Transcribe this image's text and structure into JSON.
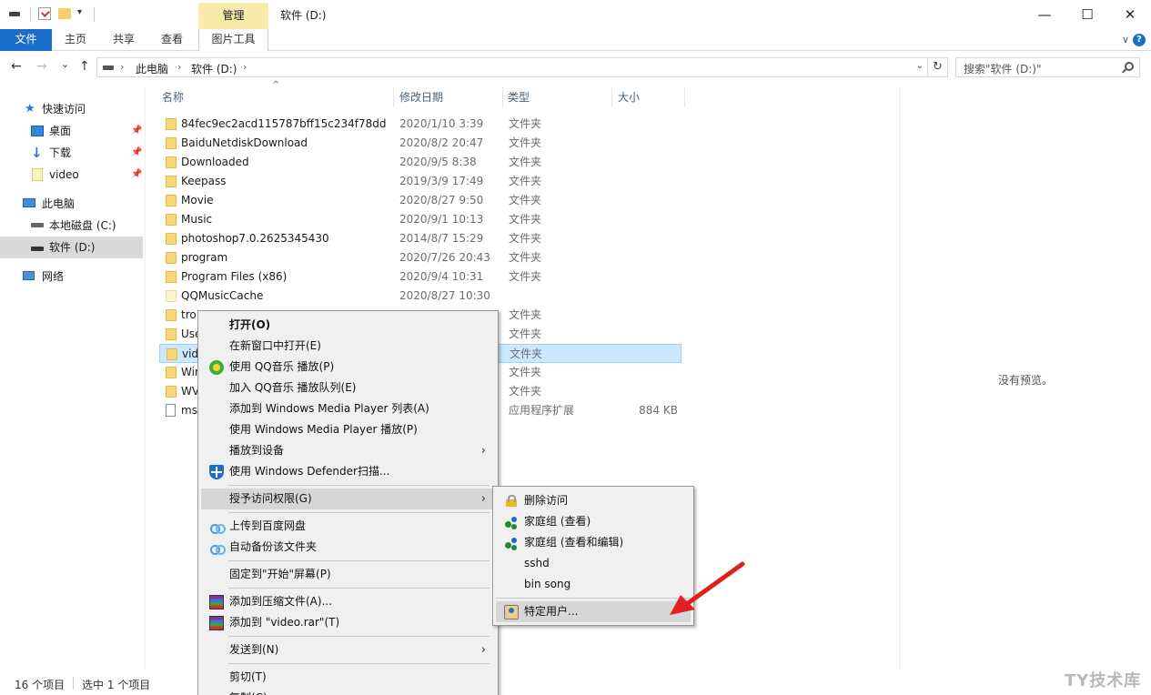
{
  "titlebar": {
    "manage_tab": "管理",
    "window_title": "软件 (D:)",
    "qa_dropdown": "▾",
    "minimize": "—",
    "maximize": "☐",
    "close": "✕"
  },
  "ribbon": {
    "tabs": [
      "文件",
      "主页",
      "共享",
      "查看",
      "图片工具"
    ],
    "expand_icon": "chevron-down-icon",
    "help_icon": "help-icon",
    "expand_glyph": "∨",
    "help_glyph": "?"
  },
  "nav": {
    "back": "←",
    "forward": "→",
    "recent": "⌄",
    "up": "↑",
    "breadcrumb": [
      "此电脑",
      "软件 (D:)"
    ],
    "sep": "›",
    "addr_dropdown": "⌄",
    "refresh": "↻",
    "search_placeholder": "搜索\"软件 (D:)\""
  },
  "sidebar": {
    "items": [
      {
        "label": "快速访问",
        "icon": "star-icon"
      },
      {
        "label": "桌面",
        "icon": "desktop-icon",
        "pinned": true
      },
      {
        "label": "下载",
        "icon": "download-icon",
        "pinned": true
      },
      {
        "label": "video",
        "icon": "folder-icon",
        "pinned": true
      },
      {
        "label": "此电脑",
        "icon": "computer-icon"
      },
      {
        "label": "本地磁盘 (C:)",
        "icon": "drive-icon"
      },
      {
        "label": "软件 (D:)",
        "icon": "drive-icon",
        "selected": true
      },
      {
        "label": "网络",
        "icon": "network-icon"
      }
    ],
    "pin_glyph": "📌"
  },
  "filelist": {
    "columns": [
      "名称",
      "修改日期",
      "类型",
      "大小"
    ],
    "sort_glyph": "^",
    "rows": [
      {
        "name": "84fec9ec2acd115787bff15c234f78dd",
        "date": "2020/1/10 3:39",
        "type": "文件夹",
        "size": ""
      },
      {
        "name": "BaiduNetdiskDownload",
        "date": "2020/8/2 20:47",
        "type": "文件夹",
        "size": ""
      },
      {
        "name": "Downloaded",
        "date": "2020/9/5 8:38",
        "type": "文件夹",
        "size": ""
      },
      {
        "name": "Keepass",
        "date": "2019/3/9 17:49",
        "type": "文件夹",
        "size": ""
      },
      {
        "name": "Movie",
        "date": "2020/8/27 9:50",
        "type": "文件夹",
        "size": ""
      },
      {
        "name": "Music",
        "date": "2020/9/1 10:13",
        "type": "文件夹",
        "size": ""
      },
      {
        "name": "photoshop7.0.2625345430",
        "date": "2014/8/7 15:29",
        "type": "文件夹",
        "size": ""
      },
      {
        "name": "program",
        "date": "2020/7/26 20:43",
        "type": "文件夹",
        "size": ""
      },
      {
        "name": "Program Files (x86)",
        "date": "2020/9/4 10:31",
        "type": "文件夹",
        "size": ""
      },
      {
        "name": "QQMusicCache",
        "date": "2020/8/27 10:30",
        "type": "",
        "size": ""
      },
      {
        "name": "tro",
        "date": "",
        "type": "文件夹",
        "size": ""
      },
      {
        "name": "Use",
        "date": "",
        "type": "文件夹",
        "size": ""
      },
      {
        "name": "vid",
        "date": "",
        "type": "文件夹",
        "size": "",
        "selected": true
      },
      {
        "name": "Wir",
        "date": "",
        "type": "文件夹",
        "size": ""
      },
      {
        "name": "WV",
        "date": "",
        "type": "文件夹",
        "size": ""
      },
      {
        "name": "ms",
        "date": "",
        "type": "应用程序扩展",
        "size": "884 KB",
        "file": true
      }
    ]
  },
  "preview": {
    "text": "没有预览。"
  },
  "status": {
    "count": "16 个项目",
    "selected": "选中 1 个项目"
  },
  "context_menu": {
    "items": [
      {
        "label": "打开(O)",
        "bold": true
      },
      {
        "label": "在新窗口中打开(E)"
      },
      {
        "label": "使用 QQ音乐 播放(P)",
        "icon": "qq-music-icon"
      },
      {
        "label": "加入 QQ音乐 播放队列(E)"
      },
      {
        "label": "添加到 Windows Media Player 列表(A)"
      },
      {
        "label": "使用 Windows Media Player 播放(P)"
      },
      {
        "label": "播放到设备",
        "submenu": true
      },
      {
        "label": "使用 Windows Defender扫描...",
        "icon": "defender-shield-icon"
      },
      {
        "sep": true
      },
      {
        "label": "授予访问权限(G)",
        "submenu": true,
        "highlight": true
      },
      {
        "sep": true
      },
      {
        "label": "上传到百度网盘",
        "icon": "baidu-netdisk-icon"
      },
      {
        "label": "自动备份该文件夹",
        "icon": "baidu-netdisk-icon"
      },
      {
        "sep": true
      },
      {
        "label": "固定到\"开始\"屏幕(P)"
      },
      {
        "sep": true
      },
      {
        "label": "添加到压缩文件(A)...",
        "icon": "winrar-icon"
      },
      {
        "label": "添加到 \"video.rar\"(T)",
        "icon": "winrar-icon"
      },
      {
        "sep": true
      },
      {
        "label": "发送到(N)",
        "submenu": true
      },
      {
        "sep": true
      },
      {
        "label": "剪切(T)"
      },
      {
        "label": "复制(C)"
      }
    ],
    "submenu_glyph": "›"
  },
  "sub_menu": {
    "items": [
      {
        "label": "删除访问",
        "icon": "lock-icon"
      },
      {
        "label": "家庭组 (查看)",
        "icon": "homegroup-icon"
      },
      {
        "label": "家庭组 (查看和编辑)",
        "icon": "homegroup-icon"
      },
      {
        "label": "sshd"
      },
      {
        "label": "bin song"
      },
      {
        "sep": true
      },
      {
        "label": "特定用户...",
        "icon": "users-icon",
        "highlight": true
      }
    ]
  },
  "watermark": "TY技术库",
  "colors": {
    "accent": "#1a6fc9",
    "selection": "#cce8ff",
    "arrow": "#e02020"
  }
}
